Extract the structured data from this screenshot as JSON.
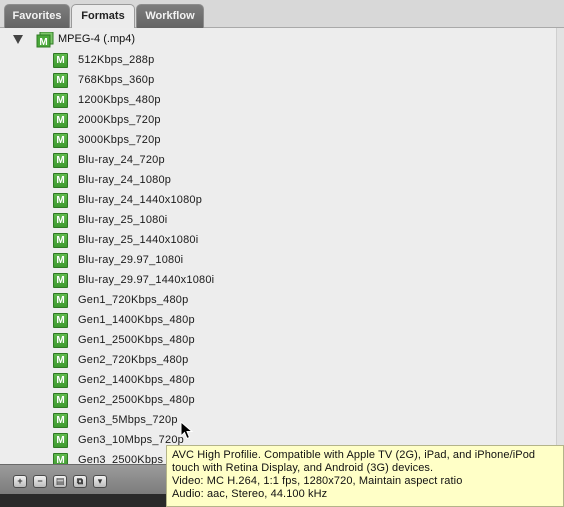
{
  "tabs": [
    {
      "label": "Favorites",
      "active": false
    },
    {
      "label": "Formats",
      "active": true
    },
    {
      "label": "Workflow",
      "active": false
    }
  ],
  "group": {
    "label": "MPEG-4 (.mp4)",
    "expanded": true,
    "icon": "mpeg4-icon"
  },
  "items": [
    "512Kbps_288p",
    "768Kbps_360p",
    "1200Kbps_480p",
    "2000Kbps_720p",
    "3000Kbps_720p",
    "Blu-ray_24_720p",
    "Blu-ray_24_1080p",
    "Blu-ray_24_1440x1080p",
    "Blu-ray_25_1080i",
    "Blu-ray_25_1440x1080i",
    "Blu-ray_29.97_1080i",
    "Blu-ray_29.97_1440x1080i",
    "Gen1_720Kbps_480p",
    "Gen1_1400Kbps_480p",
    "Gen1_2500Kbps_480p",
    "Gen2_720Kbps_480p",
    "Gen2_1400Kbps_480p",
    "Gen2_2500Kbps_480p",
    "Gen3_5Mbps_720p",
    "Gen3_10Mbps_720p",
    "Gen3_2500Kbps_"
  ],
  "item_icon_letter": "M",
  "toolbar": {
    "buttons": [
      {
        "name": "add-icon",
        "glyph": "+"
      },
      {
        "name": "remove-icon",
        "glyph": "−"
      },
      {
        "name": "settings-icon",
        "glyph": "▤"
      },
      {
        "name": "duplicate-icon",
        "glyph": "⧉"
      },
      {
        "name": "menu-icon",
        "glyph": "▾"
      }
    ]
  },
  "tooltip": {
    "lines": [
      "AVC High Profilie. Compatible with Apple TV (2G), iPad, and iPhone/iPod",
      "touch with Retina Display, and Android (3G) devices.",
      "Video: MC H.264, 1:1 fps, 1280x720, Maintain aspect ratio",
      "Audio: aac, Stereo, 44.100 kHz"
    ]
  },
  "colors": {
    "icon_green": "#4aa83a",
    "tooltip_bg": "#ffffc7",
    "tab_active": "#ececec",
    "tab_inactive": "#6e6e6e"
  }
}
